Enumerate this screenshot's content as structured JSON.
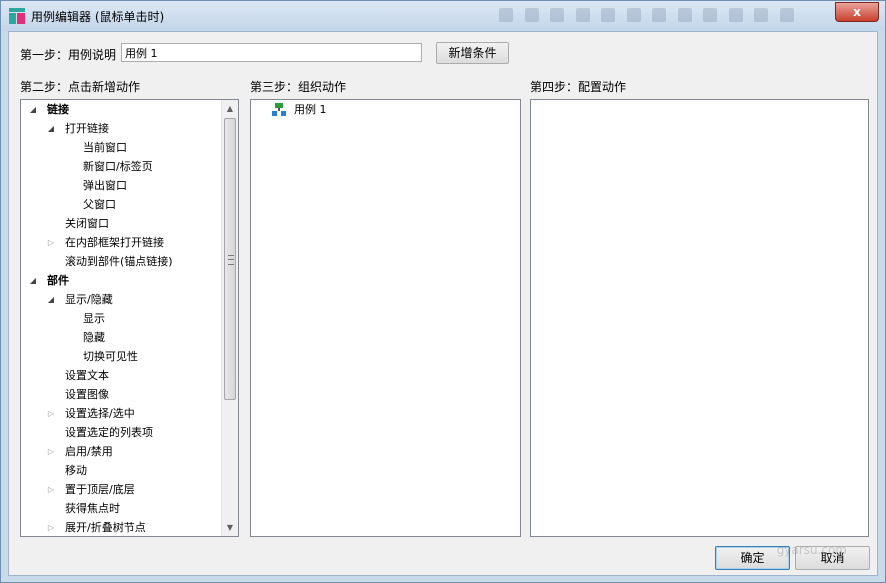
{
  "window": {
    "title": "用例编辑器 (鼠标单击时)",
    "close_label": "x"
  },
  "step1": {
    "label": "第一步：用例说明",
    "input_value": "用例 1",
    "add_condition_label": "新增条件"
  },
  "step2": {
    "label": "第二步：点击新增动作",
    "tree": [
      {
        "text": "链接",
        "indent": 0,
        "arrow": "expanded",
        "bold": true
      },
      {
        "text": "打开链接",
        "indent": 1,
        "arrow": "expanded",
        "bold": false
      },
      {
        "text": "当前窗口",
        "indent": 2,
        "arrow": "none",
        "bold": false
      },
      {
        "text": "新窗口/标签页",
        "indent": 2,
        "arrow": "none",
        "bold": false
      },
      {
        "text": "弹出窗口",
        "indent": 2,
        "arrow": "none",
        "bold": false
      },
      {
        "text": "父窗口",
        "indent": 2,
        "arrow": "none",
        "bold": false
      },
      {
        "text": "关闭窗口",
        "indent": 1,
        "arrow": "none",
        "bold": false
      },
      {
        "text": "在内部框架打开链接",
        "indent": 1,
        "arrow": "collapsed",
        "bold": false
      },
      {
        "text": "滚动到部件(锚点链接)",
        "indent": 1,
        "arrow": "none",
        "bold": false
      },
      {
        "text": "部件",
        "indent": 0,
        "arrow": "expanded",
        "bold": true
      },
      {
        "text": "显示/隐藏",
        "indent": 1,
        "arrow": "expanded",
        "bold": false
      },
      {
        "text": "显示",
        "indent": 2,
        "arrow": "none",
        "bold": false
      },
      {
        "text": "隐藏",
        "indent": 2,
        "arrow": "none",
        "bold": false
      },
      {
        "text": "切换可见性",
        "indent": 2,
        "arrow": "none",
        "bold": false
      },
      {
        "text": "设置文本",
        "indent": 1,
        "arrow": "none",
        "bold": false
      },
      {
        "text": "设置图像",
        "indent": 1,
        "arrow": "none",
        "bold": false
      },
      {
        "text": "设置选择/选中",
        "indent": 1,
        "arrow": "collapsed",
        "bold": false
      },
      {
        "text": "设置选定的列表项",
        "indent": 1,
        "arrow": "none",
        "bold": false
      },
      {
        "text": "启用/禁用",
        "indent": 1,
        "arrow": "collapsed",
        "bold": false
      },
      {
        "text": "移动",
        "indent": 1,
        "arrow": "none",
        "bold": false
      },
      {
        "text": "置于顶层/底层",
        "indent": 1,
        "arrow": "collapsed",
        "bold": false
      },
      {
        "text": "获得焦点时",
        "indent": 1,
        "arrow": "none",
        "bold": false
      },
      {
        "text": "展开/折叠树节点",
        "indent": 1,
        "arrow": "collapsed",
        "bold": false
      }
    ]
  },
  "step3": {
    "label": "第三步：组织动作",
    "case_label": "用例 1"
  },
  "step4": {
    "label": "第四步：配置动作"
  },
  "footer": {
    "ok_label": "确定",
    "cancel_label": "取消",
    "watermark": "gyarsu.com"
  }
}
